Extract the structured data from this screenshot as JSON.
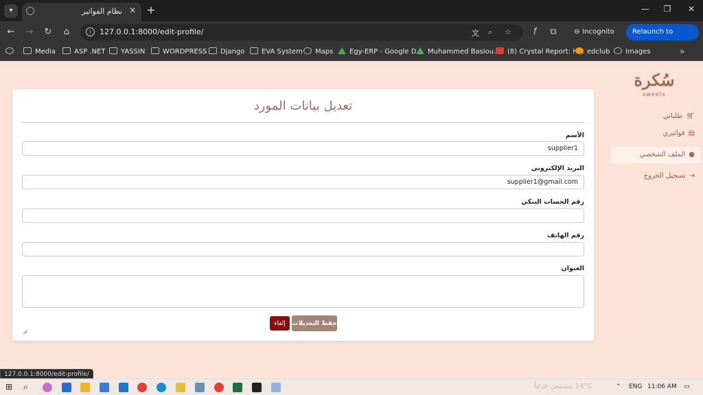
{
  "browser": {
    "tab_title": "نظام الفواتير",
    "url": "127.0.0.1:8000/edit-profile/",
    "incognito_label": "Incognito",
    "relaunch_label": "Relaunch to update",
    "status_url": "127.0.0.1:8000/edit-profile/",
    "bookmarks": [
      {
        "label": "Media",
        "icon": "folder-icon"
      },
      {
        "label": "ASP .NET",
        "icon": "folder-icon"
      },
      {
        "label": "YASSIN",
        "icon": "folder-icon"
      },
      {
        "label": "WORDPRESS",
        "icon": "folder-icon"
      },
      {
        "label": "Django",
        "icon": "folder-icon"
      },
      {
        "label": "EVA System",
        "icon": "folder-icon"
      },
      {
        "label": "Maps",
        "icon": "maps-icon"
      },
      {
        "label": "Egy-ERP - Google D...",
        "icon": "drive-icon"
      },
      {
        "label": "Muhammed Basiou...",
        "icon": "drive-icon"
      },
      {
        "label": "(8) Crystal Report: H...",
        "icon": "youtube-icon"
      },
      {
        "label": "edclub",
        "icon": "edclub-icon"
      },
      {
        "label": "Images",
        "icon": "globe-icon"
      }
    ]
  },
  "sidebar": {
    "logo_text": "سُكرة",
    "logo_sub": "sweets",
    "items": [
      {
        "label": "طلباتي",
        "icon": "cart-icon",
        "active": false
      },
      {
        "label": "فواتيري",
        "icon": "invoice-icon",
        "active": false
      },
      {
        "label": "الملف الشخصي",
        "icon": "user-icon",
        "active": true
      },
      {
        "label": "تسجيل الخروج",
        "icon": "logout-icon",
        "active": false
      }
    ]
  },
  "form": {
    "title": "تعديل بيانات المورد",
    "name_label": "الأسم",
    "name_value": "supplier1",
    "email_label": "البريد الإلكتروني",
    "email_value": "supplier1@gmail.com",
    "bank_label": "رقم الحساب البنكي",
    "bank_value": "",
    "phone_label": "رقم الهاتف",
    "phone_value": "",
    "address_label": "العنوان",
    "address_value": "",
    "save_label": "حفظ التعديلات",
    "cancel_label": "إلغاء"
  },
  "taskbar": {
    "weather": "14°C  مشمس جزئياً",
    "lang": "ENG",
    "time": "11:06 AM"
  },
  "colors": {
    "page_bg": "#fce3d8",
    "accent": "#a58478",
    "cancel": "#8b0d0d",
    "relaunch": "#0b57d0"
  }
}
